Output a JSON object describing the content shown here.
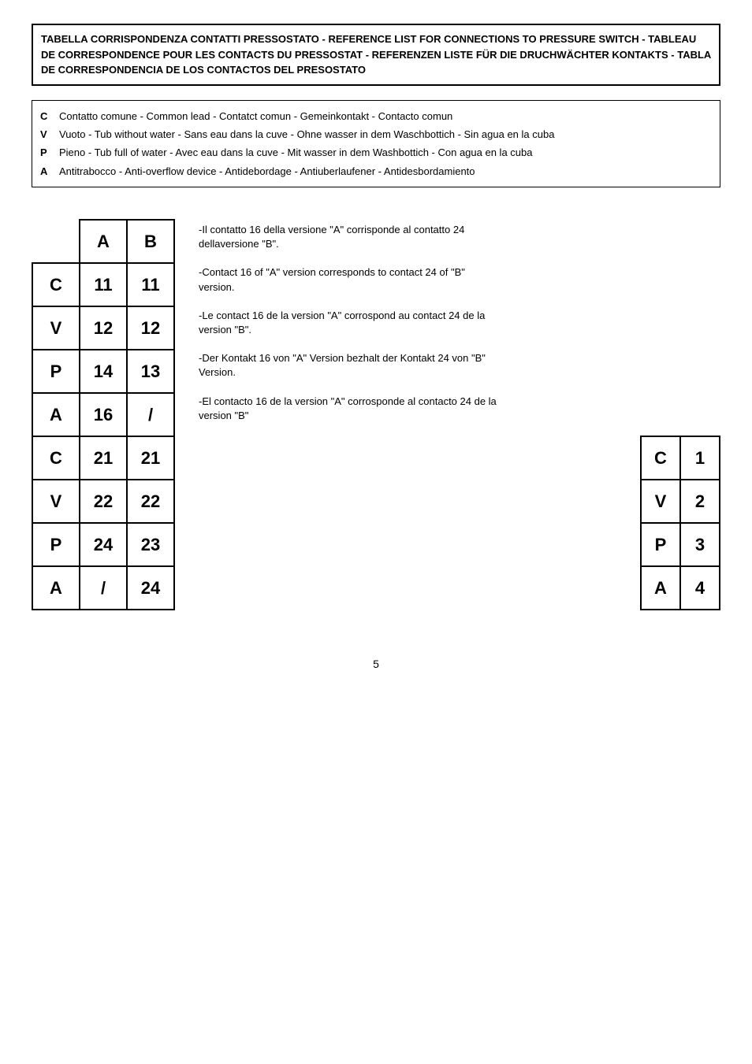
{
  "title": {
    "text": "TABELLA CORRISPONDENZA CONTATTI PRESSOSTATO - REFERENCE LIST FOR CONNECTIONS TO PRESSURE SWITCH - TABLEAU DE CORRESPONDENCE POUR LES CONTACTS DU PRESSOSTAT - REFERENZEN LISTE FÜR DIE DRUCHWÄCHTER KONTAKTS - TABLA DE CORRESPONDENCIA DE LOS CONTACTOS DEL PRESOSTATO"
  },
  "legend": {
    "items": [
      {
        "key": "C",
        "text": "Contatto comune - Common lead - Contatct comun - Gemeinkontakt - Contacto comun"
      },
      {
        "key": "V",
        "text": "Vuoto - Tub without water - Sans eau dans la cuve - Ohne wasser in dem Waschbottich - Sin agua en la cuba"
      },
      {
        "key": "P",
        "text": "Pieno - Tub full of water - Avec eau dans la cuve - Mit wasser in dem Washbottich - Con agua en la cuba"
      },
      {
        "key": "A",
        "text": "Antitrabocco - Anti-overflow device - Antidebordage - Antiuberlaufener - Antidesbordamiento"
      }
    ]
  },
  "main_table": {
    "headers": [
      "",
      "A",
      "B"
    ],
    "rows": [
      {
        "label": "C",
        "a": "11",
        "b": "11"
      },
      {
        "label": "V",
        "a": "12",
        "b": "12"
      },
      {
        "label": "P",
        "a": "14",
        "b": "13"
      },
      {
        "label": "A",
        "a": "16",
        "b": "/"
      },
      {
        "label": "C",
        "a": "21",
        "b": "21"
      },
      {
        "label": "V",
        "a": "22",
        "b": "22"
      },
      {
        "label": "P",
        "a": "24",
        "b": "23"
      },
      {
        "label": "A",
        "a": "/",
        "b": "24"
      }
    ]
  },
  "notes": [
    "-Il contatto 16 della versione \"A\" corrisponde al contatto 24 dellaversione \"B\".",
    "-Contact 16 of \"A\" version corresponds to contact 24 of \"B\" version.",
    "-Le contact 16 de la version \"A\" corrospond au contact 24 de la version \"B\".",
    "-Der Kontakt 16 von \"A\" Version bezhalt der Kontakt 24 von \"B\" Version.",
    "-El contacto 16 de la version \"A\" corrosponde al contacto 24 de la version \"B\""
  ],
  "right_table": {
    "rows": [
      {
        "label": "C",
        "val": "1"
      },
      {
        "label": "V",
        "val": "2"
      },
      {
        "label": "P",
        "val": "3"
      },
      {
        "label": "A",
        "val": "4"
      }
    ]
  },
  "page_number": "5"
}
